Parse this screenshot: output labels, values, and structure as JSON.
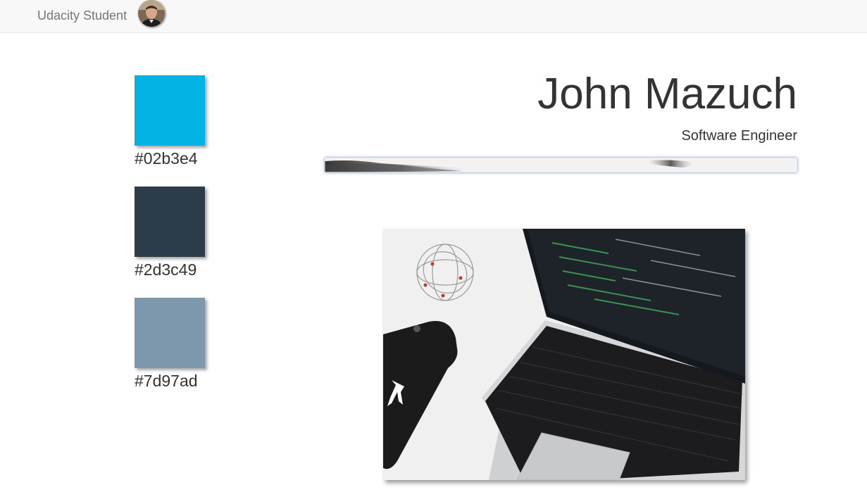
{
  "navbar": {
    "brand": "Udacity Student",
    "avatar_icon": "profile-photo-icon"
  },
  "palette": {
    "swatches": [
      {
        "color": "#02b3e4",
        "label": "#02b3e4"
      },
      {
        "color": "#2d3c49",
        "label": "#2d3c49"
      },
      {
        "color": "#7d97ad",
        "label": "#7d97ad"
      }
    ]
  },
  "header": {
    "name": "John Mazuch",
    "title": "Software Engineer"
  },
  "hero_image": {
    "icon": "laptop-phone-desk-photo"
  }
}
